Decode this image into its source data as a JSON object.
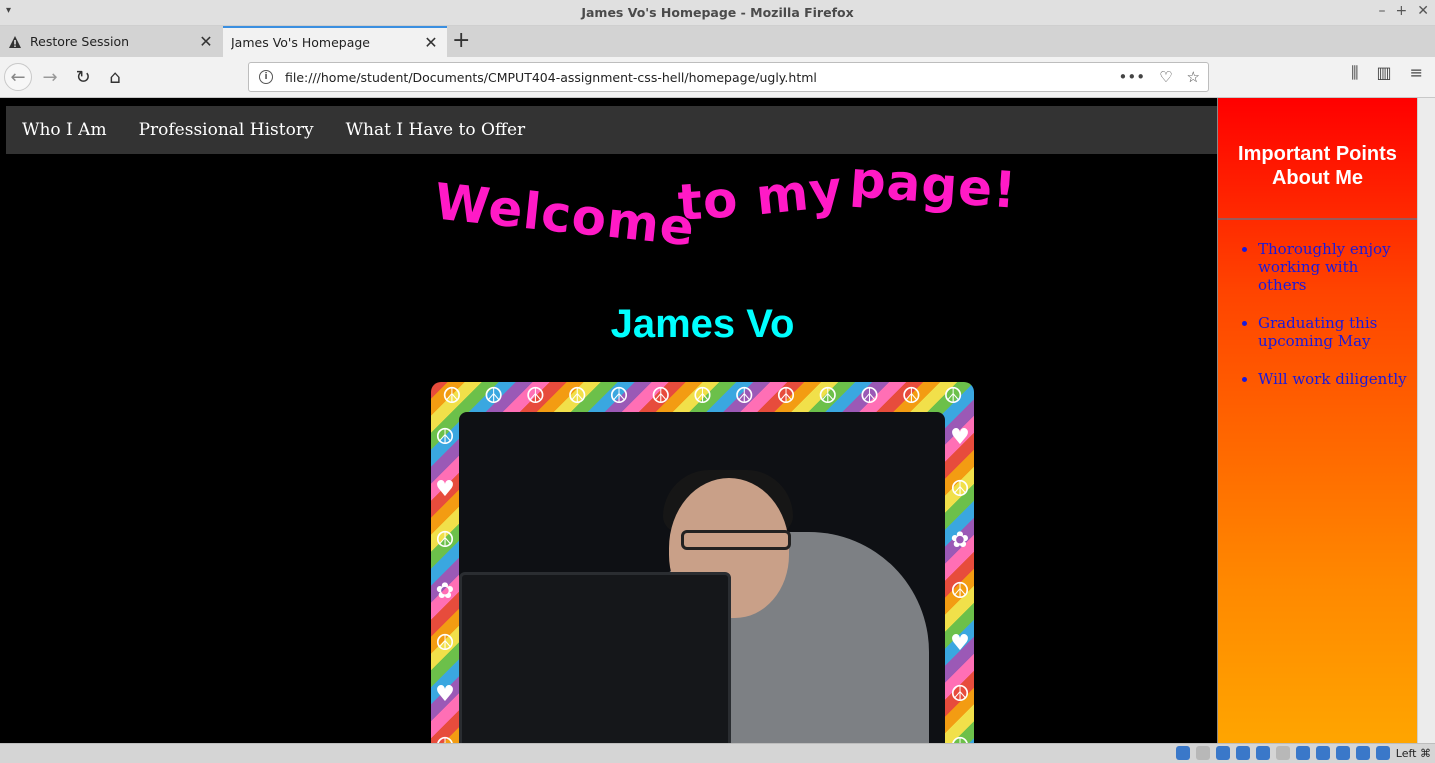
{
  "window": {
    "title": "James Vo's Homepage - Mozilla Firefox"
  },
  "tabs": [
    {
      "label": "Restore Session",
      "icon": "warning-icon"
    },
    {
      "label": "James Vo's Homepage",
      "active": true
    }
  ],
  "urlbar": {
    "url": "file:///home/student/Documents/CMPUT404-assignment-css-hell/homepage/ugly.html"
  },
  "page": {
    "nav": [
      "Who I Am",
      "Professional History",
      "What I Have to Offer"
    ],
    "welcome": {
      "words": [
        "Welcome",
        "to",
        "my",
        "page!"
      ],
      "color": "#ff1ac6"
    },
    "name": "James Vo",
    "name_color": "#00ffff",
    "sidebar": {
      "title": "Important Points About Me",
      "items": [
        "Thoroughly enjoy working with others",
        "Graduating this upcoming May",
        "Will work diligently"
      ]
    }
  },
  "taskbar": {
    "keyboard_label": "Left ⌘"
  }
}
